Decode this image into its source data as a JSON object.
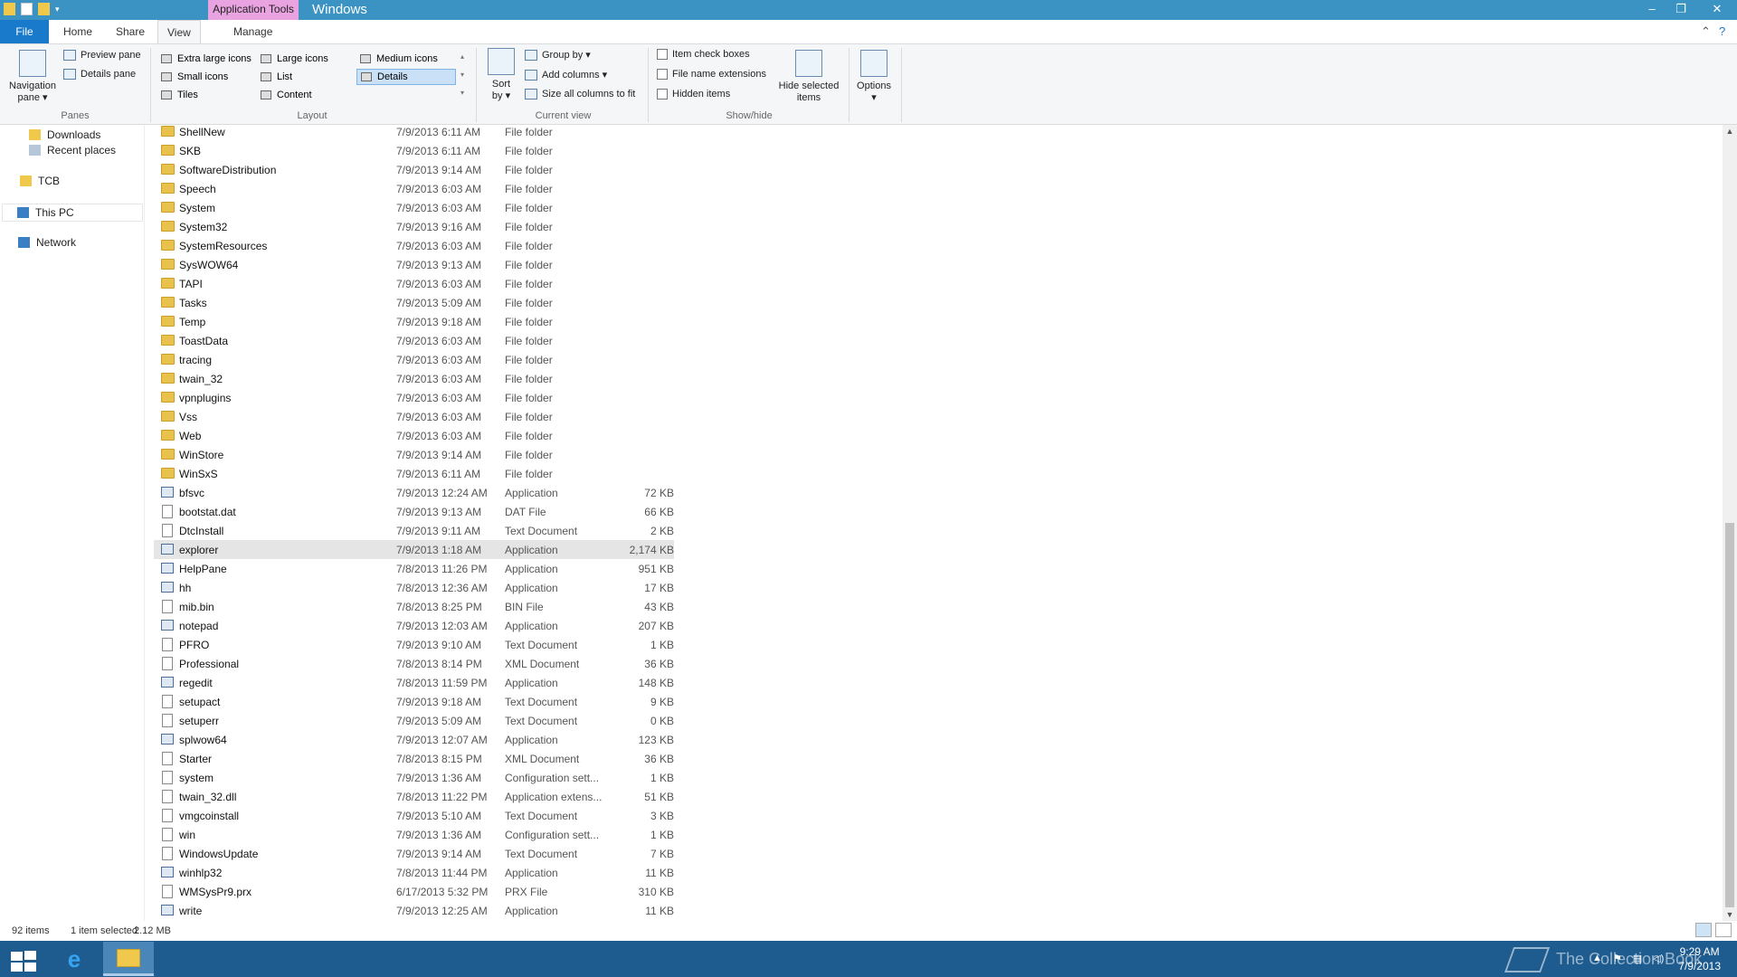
{
  "window": {
    "title": "Windows",
    "context_tab_group": "Application Tools",
    "controls": {
      "minimize": "–",
      "maximize": "❐",
      "close": "✕"
    }
  },
  "ribbon_tabs": {
    "file": "File",
    "home": "Home",
    "share": "Share",
    "view": "View",
    "manage": "Manage"
  },
  "ribbon": {
    "panes": {
      "label": "Panes",
      "navigation_pane_l1": "Navigation",
      "navigation_pane_l2": "pane ▾",
      "preview_pane": "Preview pane",
      "details_pane": "Details pane"
    },
    "layout": {
      "label": "Layout",
      "extra_large_icons": "Extra large icons",
      "large_icons": "Large icons",
      "medium_icons": "Medium icons",
      "small_icons": "Small icons",
      "list": "List",
      "details": "Details",
      "tiles": "Tiles",
      "content": "Content"
    },
    "current_view": {
      "label": "Current view",
      "sort_by_l1": "Sort",
      "sort_by_l2": "by ▾",
      "group_by": "Group by ▾",
      "add_columns": "Add columns ▾",
      "size_columns": "Size all columns to fit"
    },
    "show_hide": {
      "label": "Show/hide",
      "item_check_boxes": "Item check boxes",
      "file_name_extensions": "File name extensions",
      "hidden_items": "Hidden items",
      "hide_selected_l1": "Hide selected",
      "hide_selected_l2": "items"
    },
    "options": {
      "label": "Options",
      "arrow": "▾"
    }
  },
  "nav": {
    "downloads": "Downloads",
    "recent_places": "Recent places",
    "tcb": "TCB",
    "this_pc": "This PC",
    "network": "Network"
  },
  "files": [
    {
      "name": "ShellNew",
      "date": "7/9/2013 6:11 AM",
      "type": "File folder",
      "size": "",
      "kind": "folder"
    },
    {
      "name": "SKB",
      "date": "7/9/2013 6:11 AM",
      "type": "File folder",
      "size": "",
      "kind": "folder"
    },
    {
      "name": "SoftwareDistribution",
      "date": "7/9/2013 9:14 AM",
      "type": "File folder",
      "size": "",
      "kind": "folder"
    },
    {
      "name": "Speech",
      "date": "7/9/2013 6:03 AM",
      "type": "File folder",
      "size": "",
      "kind": "folder"
    },
    {
      "name": "System",
      "date": "7/9/2013 6:03 AM",
      "type": "File folder",
      "size": "",
      "kind": "folder"
    },
    {
      "name": "System32",
      "date": "7/9/2013 9:16 AM",
      "type": "File folder",
      "size": "",
      "kind": "folder"
    },
    {
      "name": "SystemResources",
      "date": "7/9/2013 6:03 AM",
      "type": "File folder",
      "size": "",
      "kind": "folder"
    },
    {
      "name": "SysWOW64",
      "date": "7/9/2013 9:13 AM",
      "type": "File folder",
      "size": "",
      "kind": "folder"
    },
    {
      "name": "TAPI",
      "date": "7/9/2013 6:03 AM",
      "type": "File folder",
      "size": "",
      "kind": "folder"
    },
    {
      "name": "Tasks",
      "date": "7/9/2013 5:09 AM",
      "type": "File folder",
      "size": "",
      "kind": "folder"
    },
    {
      "name": "Temp",
      "date": "7/9/2013 9:18 AM",
      "type": "File folder",
      "size": "",
      "kind": "folder"
    },
    {
      "name": "ToastData",
      "date": "7/9/2013 6:03 AM",
      "type": "File folder",
      "size": "",
      "kind": "folder"
    },
    {
      "name": "tracing",
      "date": "7/9/2013 6:03 AM",
      "type": "File folder",
      "size": "",
      "kind": "folder"
    },
    {
      "name": "twain_32",
      "date": "7/9/2013 6:03 AM",
      "type": "File folder",
      "size": "",
      "kind": "folder"
    },
    {
      "name": "vpnplugins",
      "date": "7/9/2013 6:03 AM",
      "type": "File folder",
      "size": "",
      "kind": "folder"
    },
    {
      "name": "Vss",
      "date": "7/9/2013 6:03 AM",
      "type": "File folder",
      "size": "",
      "kind": "folder"
    },
    {
      "name": "Web",
      "date": "7/9/2013 6:03 AM",
      "type": "File folder",
      "size": "",
      "kind": "folder"
    },
    {
      "name": "WinStore",
      "date": "7/9/2013 9:14 AM",
      "type": "File folder",
      "size": "",
      "kind": "folder"
    },
    {
      "name": "WinSxS",
      "date": "7/9/2013 6:11 AM",
      "type": "File folder",
      "size": "",
      "kind": "folder"
    },
    {
      "name": "bfsvc",
      "date": "7/9/2013 12:24 AM",
      "type": "Application",
      "size": "72 KB",
      "kind": "app"
    },
    {
      "name": "bootstat.dat",
      "date": "7/9/2013 9:13 AM",
      "type": "DAT File",
      "size": "66 KB",
      "kind": "file"
    },
    {
      "name": "DtcInstall",
      "date": "7/9/2013 9:11 AM",
      "type": "Text Document",
      "size": "2 KB",
      "kind": "file"
    },
    {
      "name": "explorer",
      "date": "7/9/2013 1:18 AM",
      "type": "Application",
      "size": "2,174 KB",
      "kind": "app",
      "selected": true
    },
    {
      "name": "HelpPane",
      "date": "7/8/2013 11:26 PM",
      "type": "Application",
      "size": "951 KB",
      "kind": "app"
    },
    {
      "name": "hh",
      "date": "7/8/2013 12:36 AM",
      "type": "Application",
      "size": "17 KB",
      "kind": "app"
    },
    {
      "name": "mib.bin",
      "date": "7/8/2013 8:25 PM",
      "type": "BIN File",
      "size": "43 KB",
      "kind": "file"
    },
    {
      "name": "notepad",
      "date": "7/9/2013 12:03 AM",
      "type": "Application",
      "size": "207 KB",
      "kind": "app"
    },
    {
      "name": "PFRO",
      "date": "7/9/2013 9:10 AM",
      "type": "Text Document",
      "size": "1 KB",
      "kind": "file"
    },
    {
      "name": "Professional",
      "date": "7/8/2013 8:14 PM",
      "type": "XML Document",
      "size": "36 KB",
      "kind": "file"
    },
    {
      "name": "regedit",
      "date": "7/8/2013 11:59 PM",
      "type": "Application",
      "size": "148 KB",
      "kind": "app"
    },
    {
      "name": "setupact",
      "date": "7/9/2013 9:18 AM",
      "type": "Text Document",
      "size": "9 KB",
      "kind": "file"
    },
    {
      "name": "setuperr",
      "date": "7/9/2013 5:09 AM",
      "type": "Text Document",
      "size": "0 KB",
      "kind": "file"
    },
    {
      "name": "splwow64",
      "date": "7/9/2013 12:07 AM",
      "type": "Application",
      "size": "123 KB",
      "kind": "app"
    },
    {
      "name": "Starter",
      "date": "7/8/2013 8:15 PM",
      "type": "XML Document",
      "size": "36 KB",
      "kind": "file"
    },
    {
      "name": "system",
      "date": "7/9/2013 1:36 AM",
      "type": "Configuration sett...",
      "size": "1 KB",
      "kind": "file"
    },
    {
      "name": "twain_32.dll",
      "date": "7/8/2013 11:22 PM",
      "type": "Application extens...",
      "size": "51 KB",
      "kind": "file"
    },
    {
      "name": "vmgcoinstall",
      "date": "7/9/2013 5:10 AM",
      "type": "Text Document",
      "size": "3 KB",
      "kind": "file"
    },
    {
      "name": "win",
      "date": "7/9/2013 1:36 AM",
      "type": "Configuration sett...",
      "size": "1 KB",
      "kind": "file"
    },
    {
      "name": "WindowsUpdate",
      "date": "7/9/2013 9:14 AM",
      "type": "Text Document",
      "size": "7 KB",
      "kind": "file"
    },
    {
      "name": "winhlp32",
      "date": "7/8/2013 11:44 PM",
      "type": "Application",
      "size": "11 KB",
      "kind": "app"
    },
    {
      "name": "WMSysPr9.prx",
      "date": "6/17/2013 5:32 PM",
      "type": "PRX File",
      "size": "310 KB",
      "kind": "file"
    },
    {
      "name": "write",
      "date": "7/9/2013 12:25 AM",
      "type": "Application",
      "size": "11 KB",
      "kind": "app"
    }
  ],
  "status": {
    "items": "92 items",
    "selected": "1 item selected",
    "size": "2.12 MB"
  },
  "taskbar": {
    "watermark": "The Collection Book",
    "time": "9:29 AM",
    "date": "7/9/2013"
  },
  "colors": {
    "titlebar": "#3b93c4",
    "file_tab": "#1979ca",
    "taskbar": "#1e5b8f",
    "context_tab": "#e8a3e0",
    "selection": "#e5e5e5"
  }
}
